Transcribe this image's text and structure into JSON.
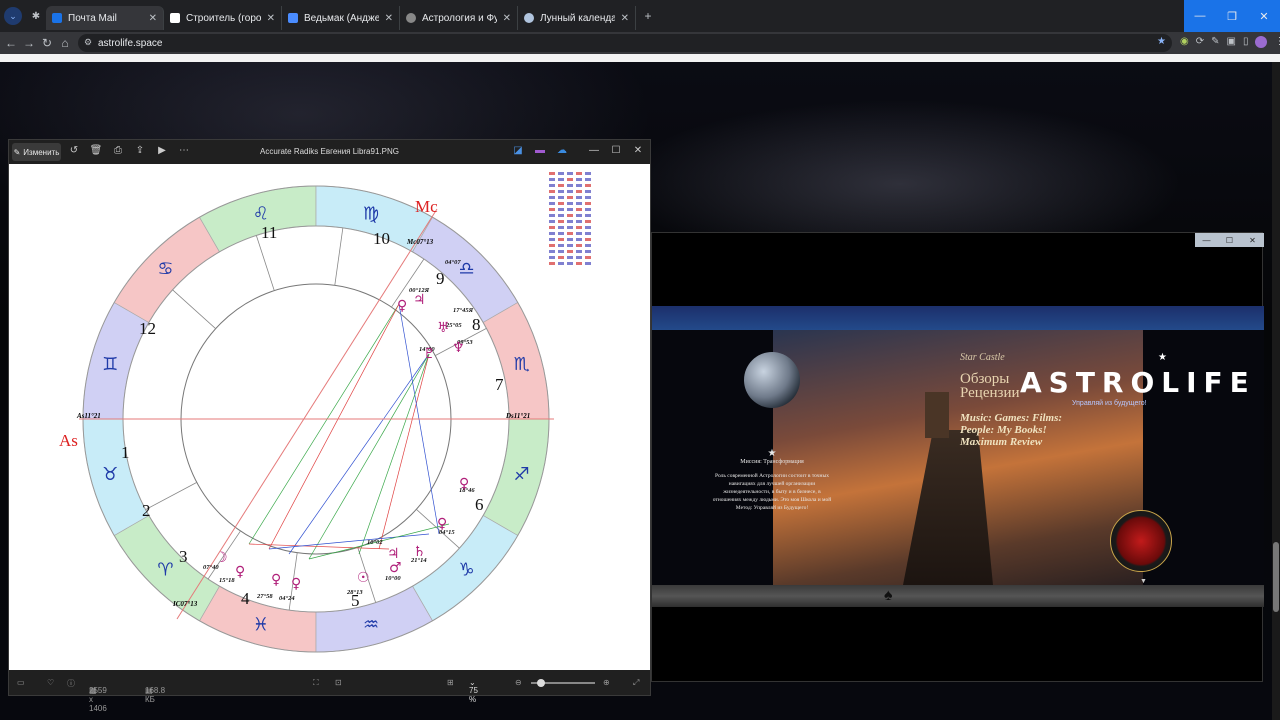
{
  "browser": {
    "tabs": [
      {
        "label": "Почта Mail",
        "color": "#1a73e8"
      },
      {
        "label": "Строитель (город) — Википедия",
        "color": "#ffffff"
      },
      {
        "label": "Ведьмак (Анджей Сапковский)",
        "color": "#4a8cff"
      },
      {
        "label": "Астрология и Футурология. Н",
        "color": "#888888"
      },
      {
        "label": "Лунный календарь на январь",
        "color": "#b0c4de"
      }
    ],
    "url": "astrolife.space"
  },
  "viewer": {
    "edit_label": "Изменить",
    "file_name": "Accurate Radiks Евгения Libra91.PNG",
    "dimensions": "2559 x 1406",
    "file_size": "168.8 КБ",
    "zoom": "75 %"
  },
  "chart": {
    "house_numbers": [
      "1",
      "2",
      "3",
      "4",
      "5",
      "6",
      "7",
      "8",
      "9",
      "10",
      "11",
      "12"
    ],
    "as_label": "As",
    "mc_label": "Mc",
    "as_degree": "As11°21",
    "dс_degree": "Ds11°21",
    "mc_degree": "Mc07°13",
    "ic_degree": "IC07°13",
    "planet_degrees": [
      "04°07",
      "00°12Я",
      "17°45Я",
      "25°05",
      "09°53",
      "14°00",
      "18°46",
      "04°15",
      "10°02",
      "21°14",
      "10°00",
      "28°13",
      "27°58",
      "04°24",
      "15°18",
      "07°40"
    ]
  },
  "astrolife": {
    "title": "ASTROLIFE",
    "subtitle": "Управляй из будущего!",
    "star_castle": "Star Castle",
    "reviews_line1": "Обзоры",
    "reviews_line2": "Рецензии",
    "music_line1": "Music: Games: Films:",
    "music_line2": "People: My Books!",
    "music_line3": "Maximum Review",
    "mission_head": "Миссия: Трансформация",
    "mission_text": "Роль современной Астрологии состоит в точных навигациях для лучшей организации жизнедеятельности, в быту и в бизнесе, в отношениях между людьми. Это моя Школа и мой Метод: Управляй из Будущего!"
  }
}
